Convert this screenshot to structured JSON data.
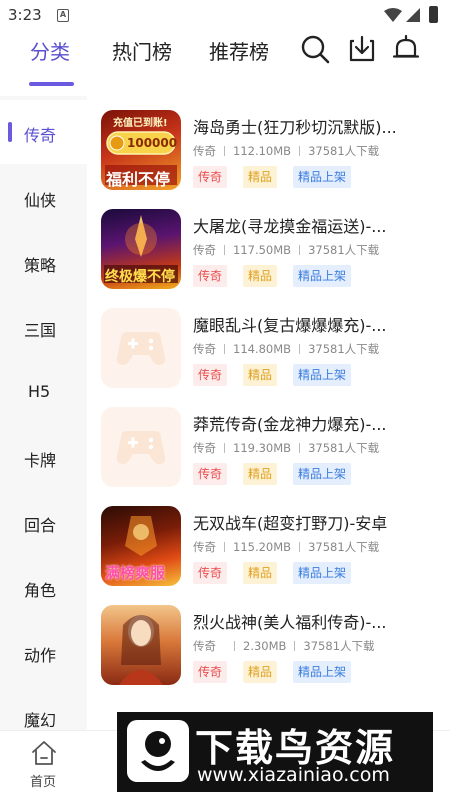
{
  "status_bar": {
    "time": "3:23",
    "sim_glyph": "A"
  },
  "header": {
    "tabs": [
      {
        "label": "分类",
        "active": true
      },
      {
        "label": "热门榜",
        "active": false
      },
      {
        "label": "推荐榜",
        "active": false
      }
    ],
    "icons": [
      "search-icon",
      "download-icon",
      "bell-icon"
    ]
  },
  "sidebar": {
    "categories": [
      "传奇",
      "仙侠",
      "策略",
      "三国",
      "H5",
      "卡牌",
      "回合",
      "角色",
      "动作",
      "魔幻"
    ],
    "active_index": 0
  },
  "games": [
    {
      "title": "海岛勇士(狂刀秒切沉默版)...",
      "genre": "传奇",
      "size": "112.10MB",
      "downloads": "37581人下载",
      "tags": [
        "传奇",
        "精品",
        "精品上架"
      ],
      "thumb_text": [
        "充值已到账!",
        "100000",
        "福利不停"
      ]
    },
    {
      "title": "大屠龙(寻龙摸金福运送)-...",
      "genre": "传奇",
      "size": "117.50MB",
      "downloads": "37581人下载",
      "tags": [
        "传奇",
        "精品",
        "精品上架"
      ],
      "thumb_text": [
        "终极爆不停"
      ]
    },
    {
      "title": "魔眼乱斗(复古爆爆爆充)-...",
      "genre": "传奇",
      "size": "114.80MB",
      "downloads": "37581人下载",
      "tags": [
        "传奇",
        "精品",
        "精品上架"
      ],
      "thumb_text": []
    },
    {
      "title": "莽荒传奇(金龙神力爆充)-...",
      "genre": "传奇",
      "size": "119.30MB",
      "downloads": "37581人下载",
      "tags": [
        "传奇",
        "精品",
        "精品上架"
      ],
      "thumb_text": []
    },
    {
      "title": "无双战车(超变打野刀)-安卓",
      "genre": "传奇",
      "size": "115.20MB",
      "downloads": "37581人下载",
      "tags": [
        "传奇",
        "精品",
        "精品上架"
      ],
      "thumb_text": [
        "满榜爽服"
      ]
    },
    {
      "title": "烈火战神(美人福利传奇)-...",
      "genre": "传奇",
      "size": "2.30MB",
      "downloads": "37581人下载",
      "tags": [
        "传奇",
        "精品",
        "精品上架"
      ],
      "thumb_text": []
    }
  ],
  "bottom_nav": {
    "home_label": "首页"
  },
  "watermark": {
    "title": "下载鸟资源",
    "url": "www.xiazainiao.com"
  },
  "colors": {
    "accent": "#5a4fcf",
    "tag_red": "#e94d4d",
    "tag_gold": "#e0a11f",
    "tag_blue": "#3a7de0"
  }
}
